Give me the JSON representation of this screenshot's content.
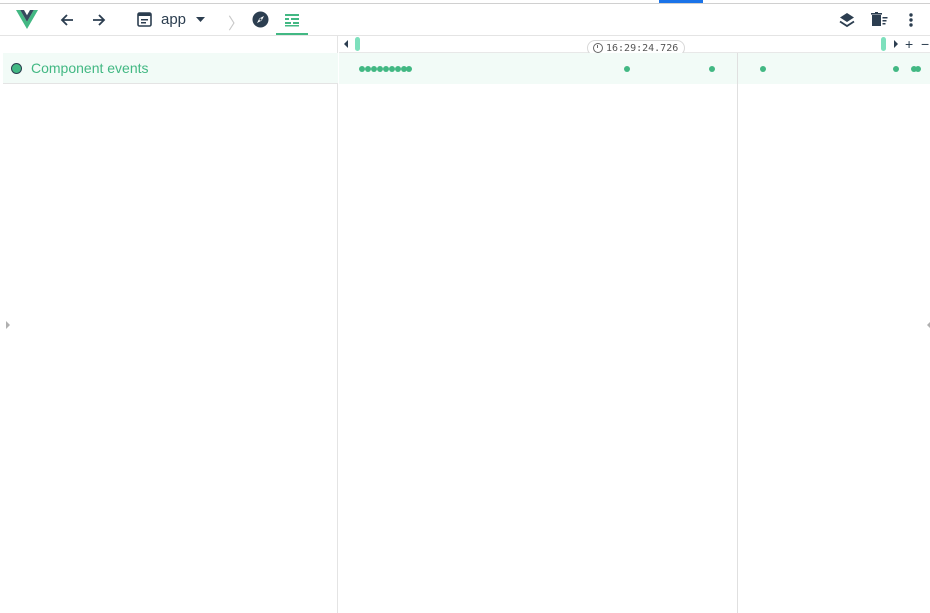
{
  "colors": {
    "accent": "#42b883",
    "dark": "#2c3e50",
    "layer_bg": "#f2fbf7",
    "handle": "#7ee0bd",
    "tab_blue": "#1a73e8"
  },
  "toolbar": {
    "logo_icon": "vue-logo-icon",
    "back_icon": "arrow-left-icon",
    "forward_icon": "arrow-right-icon",
    "app_icon": "app-window-icon",
    "app_label": "app",
    "app_dropdown_icon": "caret-down-icon",
    "breadcrumb_separator": "〉",
    "inspector_icon": "compass-icon",
    "timeline_icon": "timeline-icon",
    "layers_icon": "layers-icon",
    "clear_icon": "clear-icon",
    "more_icon": "more-vert-icon"
  },
  "timeline": {
    "layers": [
      {
        "label": "Component events"
      }
    ],
    "cursor_time": "16:29:24.726",
    "zoom_in_label": "+",
    "zoom_out_label": "−"
  }
}
